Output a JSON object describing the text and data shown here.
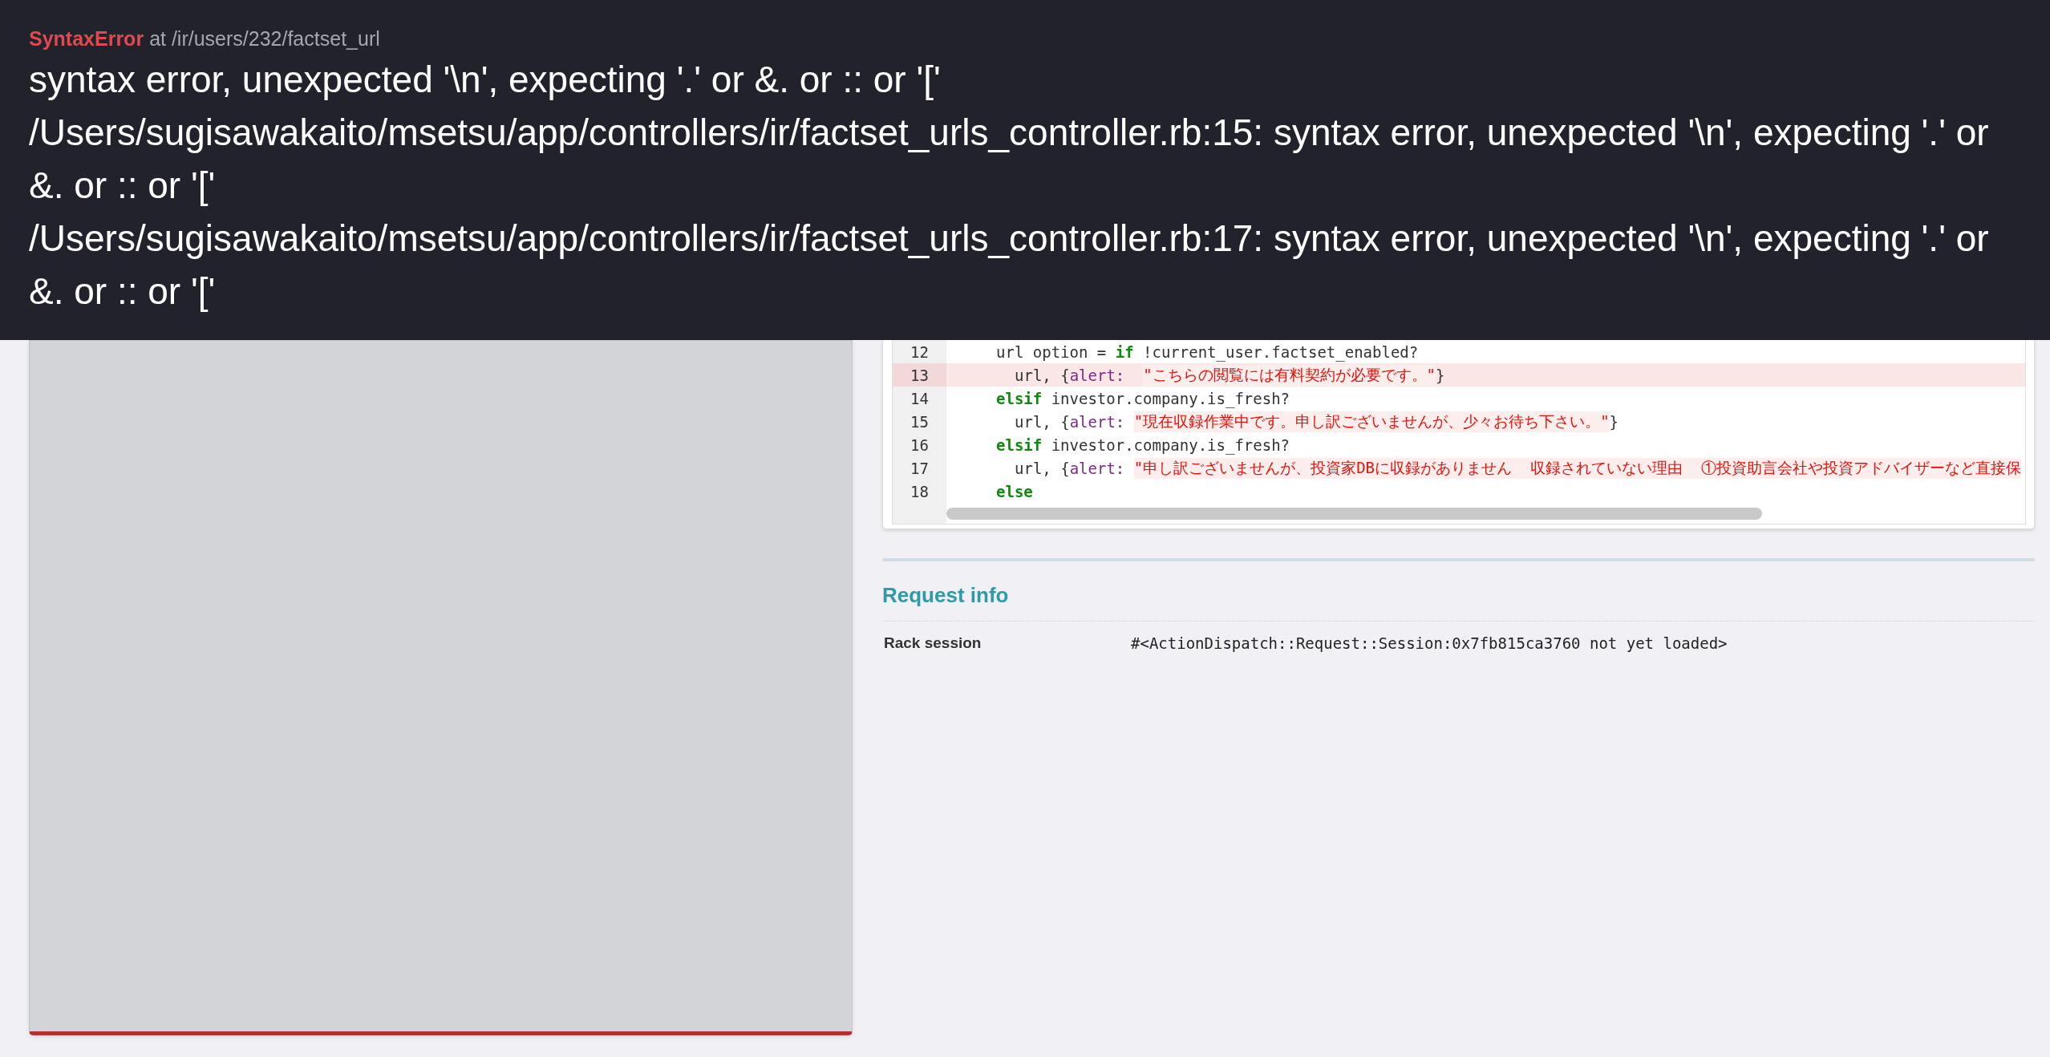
{
  "error_header": {
    "error_type": "SyntaxError",
    "location": "at /ir/users/232/factset_url",
    "messages": [
      "syntax error, unexpected '\\n', expecting '.' or &. or :: or '['",
      "/Users/sugisawakaito/msetsu/app/controllers/ir/factset_urls_controller.rb:15: syntax error, unexpected '\\n', expecting '.' or &. or :: or '['",
      "/Users/sugisawakaito/msetsu/app/controllers/ir/factset_urls_controller.rb:17: syntax error, unexpected '\\n', expecting '.' or &. or :: or '['"
    ]
  },
  "source_code": {
    "lines": [
      {
        "number": "12",
        "highlighted": false,
        "tokens": [
          {
            "kind": "plain",
            "text": "url option = "
          },
          {
            "kind": "keyword",
            "text": "if"
          },
          {
            "kind": "plain",
            "text": " !current_user.factset_enabled?"
          }
        ],
        "children": [
          {
            "number": "13",
            "highlighted": true,
            "tokens": [
              {
                "kind": "plain",
                "text": "url, {"
              },
              {
                "kind": "symbol",
                "text": "alert:  "
              },
              {
                "kind": "string",
                "text": "\"こちらの閲覧には有料契約が必要です。\""
              },
              {
                "kind": "plain",
                "text": "}"
              }
            ]
          }
        ]
      },
      {
        "number": "14",
        "highlighted": false,
        "tokens": [
          {
            "kind": "keyword",
            "text": "elsif"
          },
          {
            "kind": "plain",
            "text": " investor.company.is_fresh?"
          }
        ],
        "children": [
          {
            "number": "15",
            "highlighted": false,
            "tokens": [
              {
                "kind": "plain",
                "text": "url, {"
              },
              {
                "kind": "symbol",
                "text": "alert: "
              },
              {
                "kind": "string",
                "text": "\"現在収録作業中です。申し訳ございませんが、少々お待ち下さい。\""
              },
              {
                "kind": "plain",
                "text": "}"
              }
            ]
          }
        ]
      },
      {
        "number": "16",
        "highlighted": false,
        "tokens": [
          {
            "kind": "keyword",
            "text": "elsif"
          },
          {
            "kind": "plain",
            "text": " investor.company.is_fresh?"
          }
        ],
        "children": [
          {
            "number": "17",
            "highlighted": false,
            "tokens": [
              {
                "kind": "plain",
                "text": "url, {"
              },
              {
                "kind": "symbol",
                "text": "alert: "
              },
              {
                "kind": "string",
                "text": "\"申し訳ございませんが、投資家DBに収録がありません  収録されていない理由  ①投資助言会社や投資アドバイザーなど直接保"
              }
            ]
          }
        ]
      },
      {
        "number": "18",
        "highlighted": false,
        "tokens": [
          {
            "kind": "keyword",
            "text": "else"
          }
        ]
      }
    ]
  },
  "request_info": {
    "title": "Request info",
    "rows": [
      {
        "label": "Rack session",
        "value": "#<ActionDispatch::Request::Session:0x7fb815ca3760 not yet loaded>"
      }
    ]
  }
}
